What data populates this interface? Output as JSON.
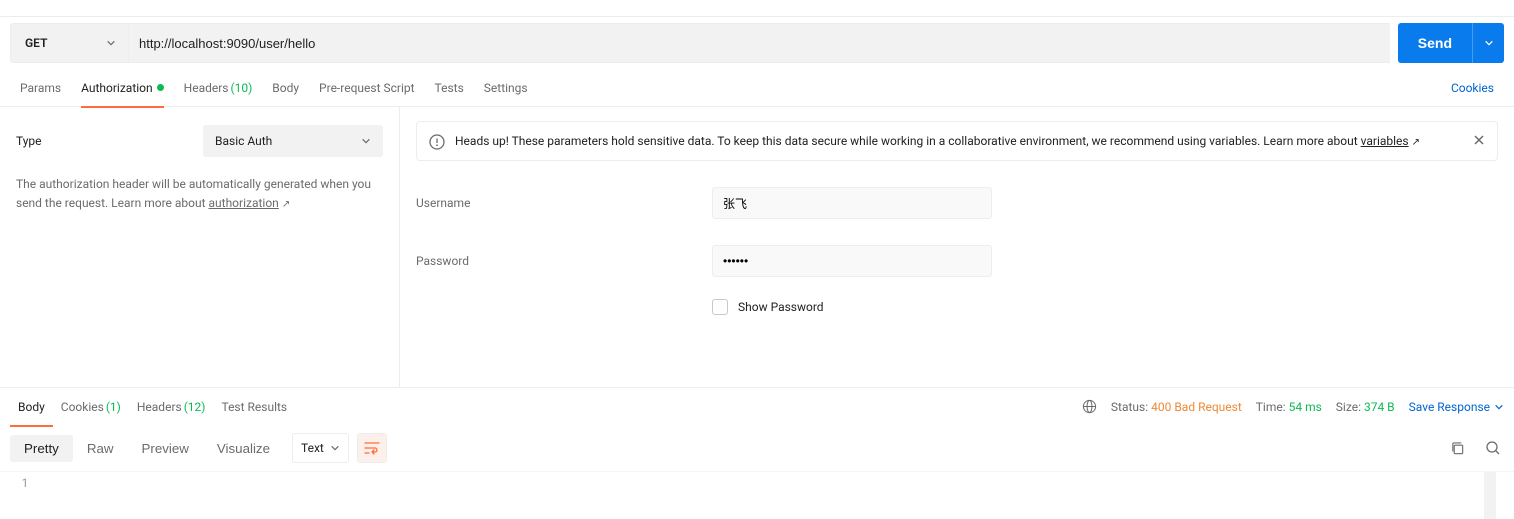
{
  "request": {
    "method": "GET",
    "url": "http://localhost:9090/user/hello",
    "send_label": "Send"
  },
  "tabs": {
    "params": "Params",
    "authorization": "Authorization",
    "headers": "Headers",
    "headers_count": "(10)",
    "body": "Body",
    "prerequest": "Pre-request Script",
    "tests": "Tests",
    "settings": "Settings",
    "cookies": "Cookies"
  },
  "auth_panel": {
    "type_label": "Type",
    "type_value": "Basic Auth",
    "help1": "The authorization header will be automatically generated when you send the request. Learn more about ",
    "help_link": "authorization"
  },
  "alert": {
    "text_before": "Heads up! These parameters hold sensitive data. To keep this data secure while working in a collaborative environment, we recommend using variables. Learn more about ",
    "link": "variables"
  },
  "form": {
    "username_label": "Username",
    "username_value": "张飞",
    "password_label": "Password",
    "password_value": "••••••",
    "show_password": "Show Password"
  },
  "response": {
    "tabs": {
      "body": "Body",
      "cookies": "Cookies",
      "cookies_count": "(1)",
      "headers": "Headers",
      "headers_count": "(12)",
      "test_results": "Test Results"
    },
    "status_label": "Status:",
    "status_code": "400 Bad Request",
    "time_label": "Time:",
    "time_value": "54 ms",
    "size_label": "Size:",
    "size_value": "374 B",
    "save": "Save Response"
  },
  "view": {
    "pretty": "Pretty",
    "raw": "Raw",
    "preview": "Preview",
    "visualize": "Visualize",
    "format": "Text"
  },
  "editor": {
    "line1": "1"
  }
}
